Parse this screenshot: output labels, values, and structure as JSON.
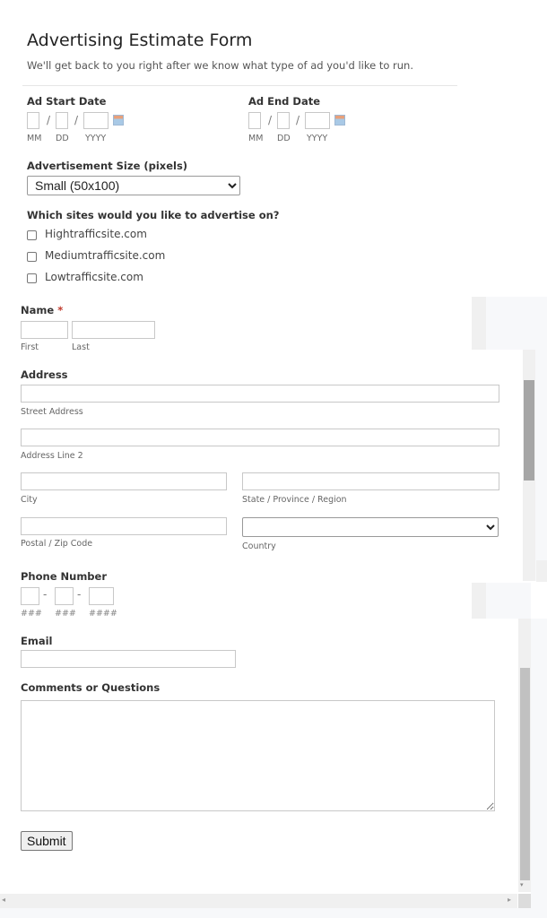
{
  "form": {
    "title": "Advertising Estimate Form",
    "description": "We'll get back to you right after we know what type of ad you'd like to run.",
    "ad_start_date": {
      "label": "Ad Start Date",
      "sub_labels": [
        "MM",
        "DD",
        "YYYY"
      ],
      "separator": "/",
      "values": [
        "",
        "",
        ""
      ]
    },
    "ad_end_date": {
      "label": "Ad End Date",
      "sub_labels": [
        "MM",
        "DD",
        "YYYY"
      ],
      "separator": "/",
      "values": [
        "",
        "",
        ""
      ]
    },
    "ad_size": {
      "label": "Advertisement Size (pixels)",
      "selected": "Small (50x100)"
    },
    "sites": {
      "label": "Which sites would you like to advertise on?",
      "options": [
        {
          "label": "Hightrafficsite.com",
          "checked": false
        },
        {
          "label": "Mediumtrafficsite.com",
          "checked": false
        },
        {
          "label": "Lowtrafficsite.com",
          "checked": false
        }
      ]
    },
    "name": {
      "label": "Name",
      "required_mark": "*",
      "first_label": "First",
      "last_label": "Last",
      "first": "",
      "last": ""
    },
    "address": {
      "label": "Address",
      "street_label": "Street Address",
      "line2_label": "Address Line 2",
      "city_label": "City",
      "state_label": "State / Province / Region",
      "zip_label": "Postal / Zip Code",
      "country_label": "Country",
      "country_selected": ""
    },
    "phone": {
      "label": "Phone Number",
      "separator": "-",
      "sub_labels": [
        "###",
        "###",
        "####"
      ]
    },
    "email": {
      "label": "Email",
      "value": ""
    },
    "comments": {
      "label": "Comments or Questions",
      "value": ""
    },
    "submit_label": "Submit"
  },
  "scrollbar": {
    "left_arrow": "◂",
    "right_arrow": "▸",
    "down_arrow": "▾"
  }
}
